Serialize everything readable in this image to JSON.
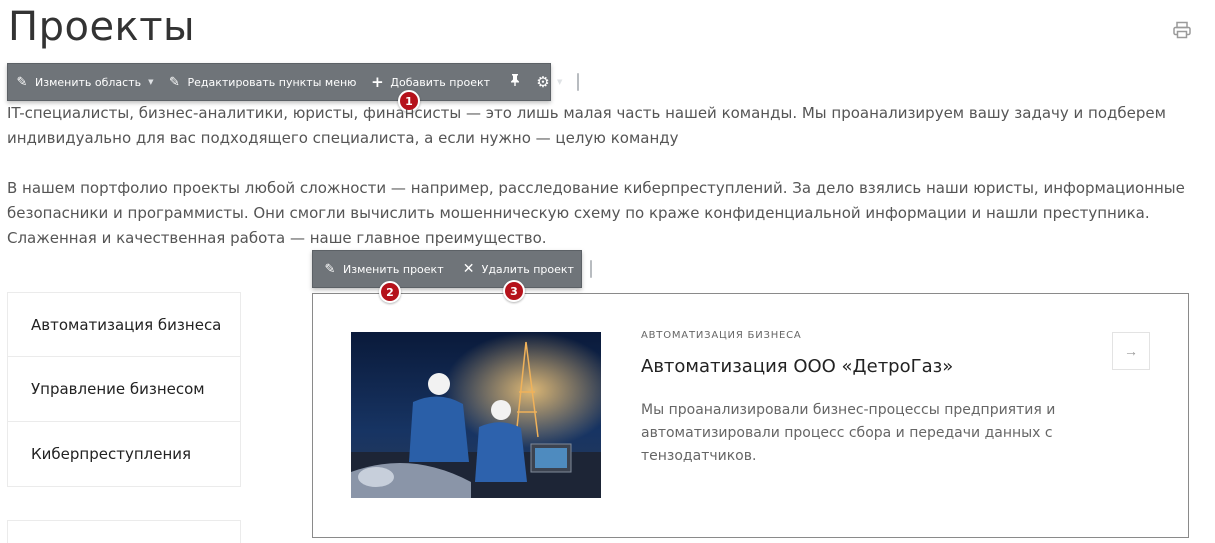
{
  "page": {
    "title": "Проекты",
    "print_icon": "printer-icon"
  },
  "toolbar_main": {
    "items": [
      {
        "label": "Изменить область",
        "icon": "pencil-icon"
      },
      {
        "label": "Редактировать пункты меню",
        "icon": "pencil-icon"
      },
      {
        "label": "Добавить проект",
        "icon": "plus-icon"
      }
    ],
    "pin_icon": "pin-icon",
    "settings_icon": "gear-icon",
    "badge": "1"
  },
  "intro": {
    "paragraph_1": "IT-специалисты, бизнес-аналитики, юристы, финансисты — это лишь малая часть нашей команды. Мы проанализируем вашу задачу и подберем индивидуально для вас подходящего специалиста, а если нужно — целую команду",
    "paragraph_2": "В нашем портфолио проекты любой сложности — например, расследование киберпреступлений. За дело взялись наши юристы, информационные безопасники и программисты. Они смогли вычислить мошенническую схему по краже конфиденциальной информации и нашли преступника. Слаженная и качественная работа — наше главное преимущество."
  },
  "toolbar_item": {
    "edit_label": "Изменить проект",
    "delete_label": "Удалить проект",
    "badge_edit": "2",
    "badge_delete": "3"
  },
  "sidebar": {
    "items": [
      {
        "label": "Автоматизация бизнеса"
      },
      {
        "label": "Управление бизнесом"
      },
      {
        "label": "Киберпреступления"
      }
    ]
  },
  "project": {
    "category": "АВТОМАТИЗАЦИЯ БИЗНЕСА",
    "title": "Автоматизация ООО «ДетроГаз»",
    "description": "Мы проанализировали бизнес-процессы предприятия и автоматизировали процесс сбора и передачи данных с тензодатчиков.",
    "arrow_icon": "arrow-right-icon"
  },
  "colors": {
    "toolbar_bg": "#6f7479",
    "badge": "#b5121b",
    "text_main": "#333333",
    "text_muted": "#666666"
  }
}
